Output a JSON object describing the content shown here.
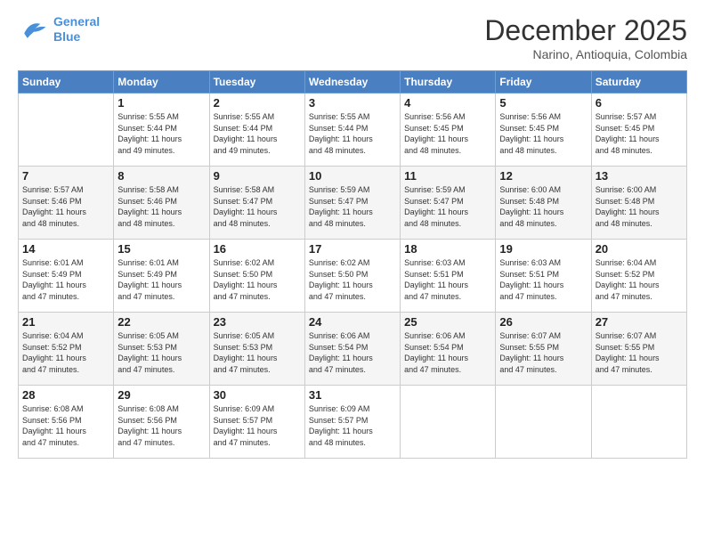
{
  "header": {
    "logo_line1": "General",
    "logo_line2": "Blue",
    "month": "December 2025",
    "location": "Narino, Antioquia, Colombia"
  },
  "weekdays": [
    "Sunday",
    "Monday",
    "Tuesday",
    "Wednesday",
    "Thursday",
    "Friday",
    "Saturday"
  ],
  "weeks": [
    [
      {
        "day": "",
        "info": ""
      },
      {
        "day": "1",
        "info": "Sunrise: 5:55 AM\nSunset: 5:44 PM\nDaylight: 11 hours\nand 49 minutes."
      },
      {
        "day": "2",
        "info": "Sunrise: 5:55 AM\nSunset: 5:44 PM\nDaylight: 11 hours\nand 49 minutes."
      },
      {
        "day": "3",
        "info": "Sunrise: 5:55 AM\nSunset: 5:44 PM\nDaylight: 11 hours\nand 48 minutes."
      },
      {
        "day": "4",
        "info": "Sunrise: 5:56 AM\nSunset: 5:45 PM\nDaylight: 11 hours\nand 48 minutes."
      },
      {
        "day": "5",
        "info": "Sunrise: 5:56 AM\nSunset: 5:45 PM\nDaylight: 11 hours\nand 48 minutes."
      },
      {
        "day": "6",
        "info": "Sunrise: 5:57 AM\nSunset: 5:45 PM\nDaylight: 11 hours\nand 48 minutes."
      }
    ],
    [
      {
        "day": "7",
        "info": "Sunrise: 5:57 AM\nSunset: 5:46 PM\nDaylight: 11 hours\nand 48 minutes."
      },
      {
        "day": "8",
        "info": "Sunrise: 5:58 AM\nSunset: 5:46 PM\nDaylight: 11 hours\nand 48 minutes."
      },
      {
        "day": "9",
        "info": "Sunrise: 5:58 AM\nSunset: 5:47 PM\nDaylight: 11 hours\nand 48 minutes."
      },
      {
        "day": "10",
        "info": "Sunrise: 5:59 AM\nSunset: 5:47 PM\nDaylight: 11 hours\nand 48 minutes."
      },
      {
        "day": "11",
        "info": "Sunrise: 5:59 AM\nSunset: 5:47 PM\nDaylight: 11 hours\nand 48 minutes."
      },
      {
        "day": "12",
        "info": "Sunrise: 6:00 AM\nSunset: 5:48 PM\nDaylight: 11 hours\nand 48 minutes."
      },
      {
        "day": "13",
        "info": "Sunrise: 6:00 AM\nSunset: 5:48 PM\nDaylight: 11 hours\nand 48 minutes."
      }
    ],
    [
      {
        "day": "14",
        "info": "Sunrise: 6:01 AM\nSunset: 5:49 PM\nDaylight: 11 hours\nand 47 minutes."
      },
      {
        "day": "15",
        "info": "Sunrise: 6:01 AM\nSunset: 5:49 PM\nDaylight: 11 hours\nand 47 minutes."
      },
      {
        "day": "16",
        "info": "Sunrise: 6:02 AM\nSunset: 5:50 PM\nDaylight: 11 hours\nand 47 minutes."
      },
      {
        "day": "17",
        "info": "Sunrise: 6:02 AM\nSunset: 5:50 PM\nDaylight: 11 hours\nand 47 minutes."
      },
      {
        "day": "18",
        "info": "Sunrise: 6:03 AM\nSunset: 5:51 PM\nDaylight: 11 hours\nand 47 minutes."
      },
      {
        "day": "19",
        "info": "Sunrise: 6:03 AM\nSunset: 5:51 PM\nDaylight: 11 hours\nand 47 minutes."
      },
      {
        "day": "20",
        "info": "Sunrise: 6:04 AM\nSunset: 5:52 PM\nDaylight: 11 hours\nand 47 minutes."
      }
    ],
    [
      {
        "day": "21",
        "info": "Sunrise: 6:04 AM\nSunset: 5:52 PM\nDaylight: 11 hours\nand 47 minutes."
      },
      {
        "day": "22",
        "info": "Sunrise: 6:05 AM\nSunset: 5:53 PM\nDaylight: 11 hours\nand 47 minutes."
      },
      {
        "day": "23",
        "info": "Sunrise: 6:05 AM\nSunset: 5:53 PM\nDaylight: 11 hours\nand 47 minutes."
      },
      {
        "day": "24",
        "info": "Sunrise: 6:06 AM\nSunset: 5:54 PM\nDaylight: 11 hours\nand 47 minutes."
      },
      {
        "day": "25",
        "info": "Sunrise: 6:06 AM\nSunset: 5:54 PM\nDaylight: 11 hours\nand 47 minutes."
      },
      {
        "day": "26",
        "info": "Sunrise: 6:07 AM\nSunset: 5:55 PM\nDaylight: 11 hours\nand 47 minutes."
      },
      {
        "day": "27",
        "info": "Sunrise: 6:07 AM\nSunset: 5:55 PM\nDaylight: 11 hours\nand 47 minutes."
      }
    ],
    [
      {
        "day": "28",
        "info": "Sunrise: 6:08 AM\nSunset: 5:56 PM\nDaylight: 11 hours\nand 47 minutes."
      },
      {
        "day": "29",
        "info": "Sunrise: 6:08 AM\nSunset: 5:56 PM\nDaylight: 11 hours\nand 47 minutes."
      },
      {
        "day": "30",
        "info": "Sunrise: 6:09 AM\nSunset: 5:57 PM\nDaylight: 11 hours\nand 47 minutes."
      },
      {
        "day": "31",
        "info": "Sunrise: 6:09 AM\nSunset: 5:57 PM\nDaylight: 11 hours\nand 48 minutes."
      },
      {
        "day": "",
        "info": ""
      },
      {
        "day": "",
        "info": ""
      },
      {
        "day": "",
        "info": ""
      }
    ]
  ]
}
